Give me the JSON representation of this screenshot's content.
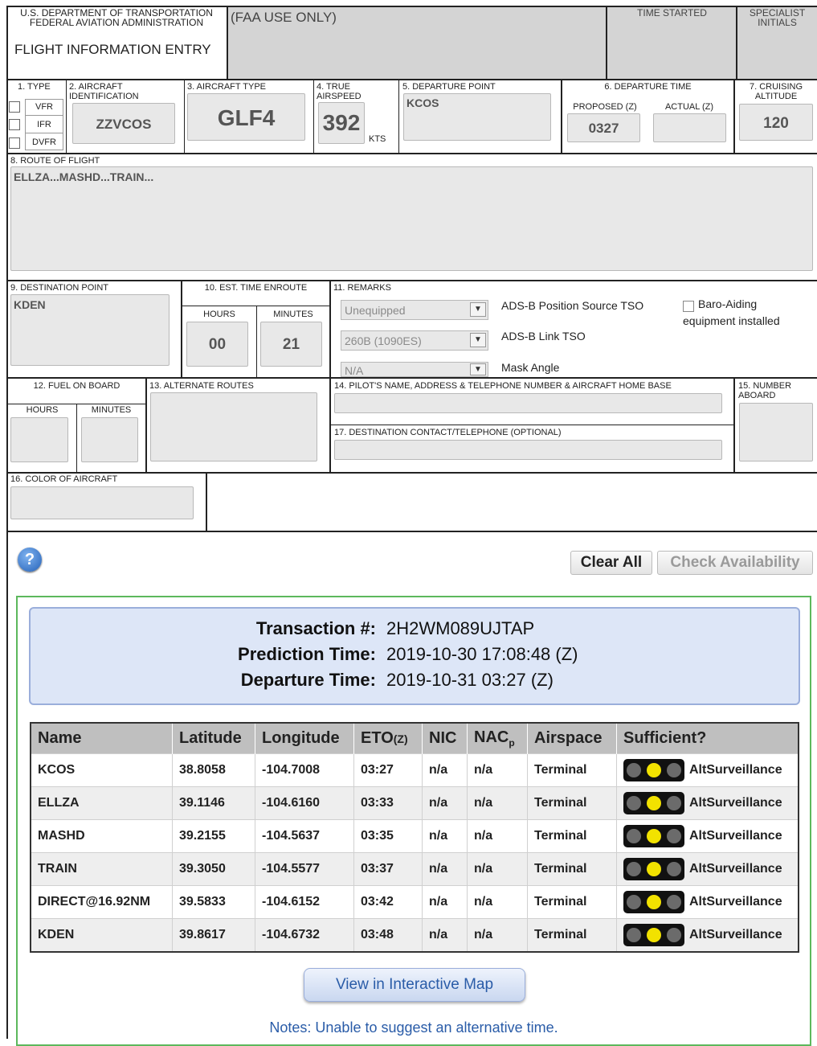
{
  "header": {
    "agency_line1": "U.S. DEPARTMENT OF TRANSPORTATION",
    "agency_line2": "FEDERAL AVIATION ADMINISTRATION",
    "form_title": "FLIGHT INFORMATION ENTRY",
    "faa_use": "(FAA USE ONLY)",
    "time_started": "TIME STARTED",
    "specialist_initials_1": "SPECIALIST",
    "specialist_initials_2": "INITIALS"
  },
  "fields": {
    "type_label": "1. TYPE",
    "type_options": [
      "VFR",
      "IFR",
      "DVFR"
    ],
    "aircraft_id_label_1": "2. AIRCRAFT",
    "aircraft_id_label_2": "IDENTIFICATION",
    "aircraft_id": "ZZVCOS",
    "aircraft_type_label": "3. AIRCRAFT TYPE",
    "aircraft_type": "GLF4",
    "true_airspeed_label_1": "4. TRUE",
    "true_airspeed_label_2": "AIRSPEED",
    "true_airspeed": "392",
    "airspeed_unit": "KTS",
    "departure_point_label": "5. DEPARTURE POINT",
    "departure_point": "KCOS",
    "departure_time_label": "6. DEPARTURE TIME",
    "proposed_label": "PROPOSED (Z)",
    "proposed": "0327",
    "actual_label": "ACTUAL (Z)",
    "actual": "",
    "cruising_altitude_label_1": "7. CRUISING",
    "cruising_altitude_label_2": "ALTITUDE",
    "cruising_altitude": "120",
    "route_label": "8. ROUTE OF FLIGHT",
    "route": "ELLZA...MASHD...TRAIN...",
    "destination_label": "9. DESTINATION POINT",
    "destination": "KDEN",
    "ete_label": "10. EST. TIME ENROUTE",
    "ete_hours_label": "HOURS",
    "ete_hours": "00",
    "ete_minutes_label": "MINUTES",
    "ete_minutes": "21",
    "remarks_label": "11. REMARKS",
    "adsb_position_select": "Unequipped",
    "adsb_position_label": "ADS-B Position Source TSO",
    "adsb_link_select": "260B (1090ES)",
    "adsb_link_label": "ADS-B Link TSO",
    "mask_angle_select": "N/A",
    "mask_angle_label": "Mask Angle",
    "baro_label_1": "Baro-Aiding",
    "baro_label_2": "equipment installed",
    "fuel_label": "12. FUEL ON BOARD",
    "fuel_hours_label": "HOURS",
    "fuel_minutes_label": "MINUTES",
    "alternate_label": "13. ALTERNATE ROUTES",
    "pilot_label": "14. PILOT'S NAME, ADDRESS & TELEPHONE NUMBER & AIRCRAFT HOME BASE",
    "number_aboard_label_1": "15. NUMBER",
    "number_aboard_label_2": "ABOARD",
    "color_label": "16. COLOR OF AIRCRAFT",
    "dest_contact_label": "17. DESTINATION CONTACT/TELEPHONE (OPTIONAL)"
  },
  "actions": {
    "help_icon": "?",
    "clear_all": "Clear All",
    "check_availability": "Check Availability"
  },
  "result": {
    "transaction_label": "Transaction #:",
    "transaction_value": "2H2WM089UJTAP",
    "prediction_label": "Prediction Time:",
    "prediction_value": "2019-10-30 17:08:48 (Z)",
    "departure_label": "Departure Time:",
    "departure_value": "2019-10-31 03:27 (Z)",
    "columns": {
      "name": "Name",
      "latitude": "Latitude",
      "longitude": "Longitude",
      "eto": "ETO",
      "eto_unit": "(Z)",
      "nic": "NIC",
      "nac": "NAC",
      "nac_sub": "p",
      "airspace": "Airspace",
      "sufficient": "Sufficient?"
    },
    "rows": [
      {
        "name": "KCOS",
        "lat": "38.8058",
        "lon": "-104.7008",
        "eto": "03:27",
        "nic": "n/a",
        "nac": "n/a",
        "airspace": "Terminal",
        "status": "AltSurveillance"
      },
      {
        "name": "ELLZA",
        "lat": "39.1146",
        "lon": "-104.6160",
        "eto": "03:33",
        "nic": "n/a",
        "nac": "n/a",
        "airspace": "Terminal",
        "status": "AltSurveillance"
      },
      {
        "name": "MASHD",
        "lat": "39.2155",
        "lon": "-104.5637",
        "eto": "03:35",
        "nic": "n/a",
        "nac": "n/a",
        "airspace": "Terminal",
        "status": "AltSurveillance"
      },
      {
        "name": "TRAIN",
        "lat": "39.3050",
        "lon": "-104.5577",
        "eto": "03:37",
        "nic": "n/a",
        "nac": "n/a",
        "airspace": "Terminal",
        "status": "AltSurveillance"
      },
      {
        "name": "DIRECT@16.92NM",
        "lat": "39.5833",
        "lon": "-104.6152",
        "eto": "03:42",
        "nic": "n/a",
        "nac": "n/a",
        "airspace": "Terminal",
        "status": "AltSurveillance"
      },
      {
        "name": "KDEN",
        "lat": "39.8617",
        "lon": "-104.6732",
        "eto": "03:48",
        "nic": "n/a",
        "nac": "n/a",
        "airspace": "Terminal",
        "status": "AltSurveillance"
      }
    ],
    "light_colors": {
      "off": "#6b6b6b",
      "on": "#f2e200"
    },
    "map_button": "View in Interactive Map",
    "notes": "Notes: Unable to suggest an alternative time."
  },
  "colors": {
    "panel_border": "#5cb85c",
    "info_bg": "#dde6f7",
    "info_border": "#9aaedb",
    "link_blue": "#2a5ca8"
  }
}
